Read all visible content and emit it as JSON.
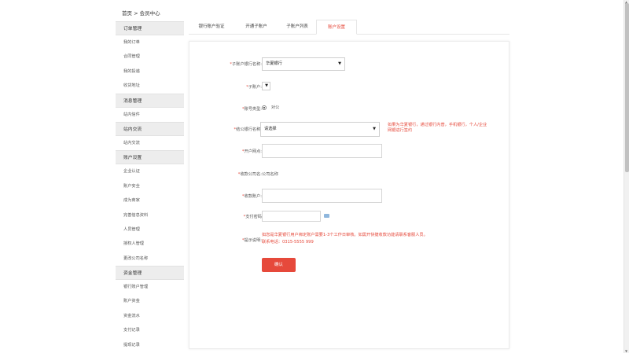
{
  "breadcrumb": "首页 > 会员中心",
  "sidebar": {
    "groups": [
      {
        "title": "订单管理",
        "items": [
          "我的订单",
          "合同管理",
          "我的投递",
          "收货地址"
        ]
      },
      {
        "title": "消息管理",
        "items": [
          "站内信件"
        ]
      },
      {
        "title": "站内交流",
        "items": [
          "站内交流"
        ]
      },
      {
        "title": "账户设置",
        "items": [
          "企业认证",
          "账户安全",
          "成为商家",
          "完善信息资料",
          "人员管理",
          "授权人管理",
          "更改公司名称"
        ]
      },
      {
        "title": "资金管理",
        "items": [
          "银行账户管理",
          "账户资金",
          "资金流水",
          "支付记录",
          "提现记录"
        ]
      }
    ]
  },
  "tabs": [
    "银行账户验证",
    "开通子账户",
    "子账户列表",
    "账户设置"
  ],
  "active_tab": 3,
  "form": {
    "bank_name": {
      "label": "子账户银行名称:",
      "value": "华夏银行"
    },
    "sub_account": {
      "label": "子账户:",
      "value": ""
    },
    "account_type": {
      "label": "账号类型:",
      "option": "对公"
    },
    "bank_select": {
      "label": "结公银行名称:",
      "value": "请选择",
      "tip": "如果为华夏银行，通过银行内普，手机银行，个人/企业网银进行签约"
    },
    "open_bank": {
      "label": "开户网点:"
    },
    "payee_name": {
      "label": "收款公司名:",
      "value": "公司名称"
    },
    "payee_account": {
      "label": "收款账户:"
    },
    "pay_password": {
      "label": "支付密码"
    },
    "notice": {
      "label": "提示说明:",
      "lines": [
        "如您是华夏银行用户绑定账户需要1-3个工作日审核。如需开快捷收款功能请联系客服人员。",
        "联系电话：0315-5555 999"
      ]
    },
    "submit": "确认"
  },
  "colors": {
    "accent": "#e6493b"
  }
}
